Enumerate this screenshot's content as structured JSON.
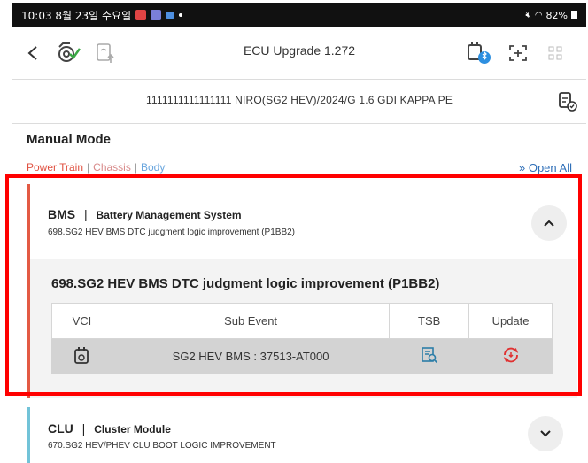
{
  "status_bar": {
    "time_date": "10:03  8월 23일 수요일",
    "battery": "82%"
  },
  "toolbar": {
    "back_icon": "chevron-left-icon",
    "title": "ECU Upgrade 1.272"
  },
  "vehicle": {
    "info": "1111111111111111  NIRO(SG2 HEV)/2024/G 1.6 GDI KAPPA PE"
  },
  "manual_mode": {
    "title": "Manual Mode",
    "filters": [
      "Power Train",
      "Chassis",
      "Body"
    ],
    "filter_separator": "|",
    "open_all": "Open All",
    "open_all_icon": "double-chevron-down-icon"
  },
  "modules": [
    {
      "code": "BMS",
      "separator": "|",
      "full_name": "Battery Management System",
      "summary": "698.SG2 HEV BMS DTC judgment logic improvement (P1BB2)",
      "accent_color": "#e35a44",
      "expanded": true,
      "event": {
        "title": "698.SG2 HEV BMS DTC judgment logic improvement (P1BB2)",
        "columns": [
          "VCI",
          "Sub Event",
          "TSB",
          "Update"
        ],
        "rows": [
          {
            "vci_icon": "vci-device-icon",
            "sub_event": "SG2 HEV BMS : 37513-AT000",
            "tsb_icon": "document-search-icon",
            "update_icon": "update-refresh-icon"
          }
        ]
      }
    },
    {
      "code": "CLU",
      "separator": "|",
      "full_name": "Cluster Module",
      "summary": "670.SG2 HEV/PHEV CLU BOOT LOGIC IMPROVEMENT",
      "accent_color": "#72c3d8",
      "expanded": false
    }
  ],
  "colors": {
    "power_train": "#e05040",
    "chassis": "#d88a8a",
    "body": "#6aa6de",
    "open_all": "#2f6fb8",
    "update_icon": "#e03030",
    "highlight": "#ff0000"
  }
}
